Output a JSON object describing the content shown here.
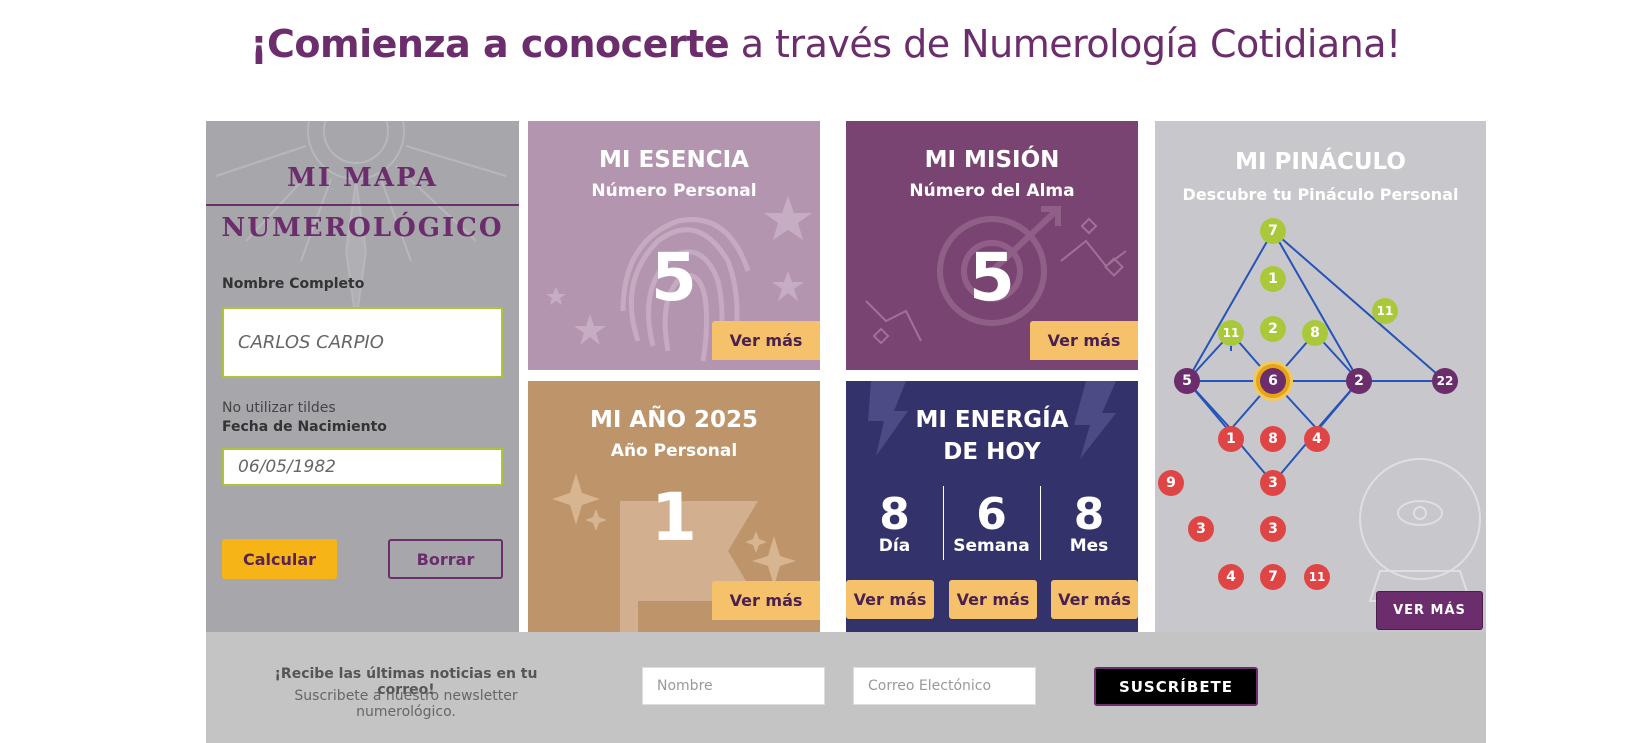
{
  "hero": {
    "bold": "¡Comienza a conocerte",
    "rest": " a través de Numerología Cotidiana!"
  },
  "mapa": {
    "title_line1": "MI MAPA",
    "title_line2": "NUMEROLÓGICO",
    "name_label": "Nombre Completo",
    "name_value": "CARLOS CARPIO",
    "name_hint": "No utilizar tildes",
    "date_label": "Fecha de Nacimiento",
    "date_value": "06/05/1982",
    "calc_button": "Calcular",
    "clear_button": "Borrar"
  },
  "cards": {
    "esencia": {
      "title": "MI ESENCIA",
      "subtitle": "Número Personal",
      "number": "5",
      "button": "Ver más"
    },
    "mision": {
      "title": "MI MISIÓN",
      "subtitle": "Número del Alma",
      "number": "5",
      "button": "Ver más"
    },
    "anio": {
      "title": "MI AÑO 2025",
      "subtitle": "Año Personal",
      "number": "1",
      "button": "Ver más"
    },
    "energia": {
      "title_line1": "MI ENERGÍA",
      "title_line2": "DE HOY",
      "items": [
        {
          "number": "8",
          "label": "Día",
          "button": "Ver más"
        },
        {
          "number": "6",
          "label": "Semana",
          "button": "Ver más"
        },
        {
          "number": "8",
          "label": "Mes",
          "button": "Ver más"
        }
      ]
    }
  },
  "pinaculo": {
    "title": "MI PINÁCULO",
    "subtitle": "Descubre tu Pináculo Personal",
    "button": "VER MÁS",
    "nodes": {
      "top": "7",
      "n1": "1",
      "n2": "2",
      "n11l": "11",
      "n8": "8",
      "n11r": "11",
      "left": "5",
      "center": "6",
      "right2": "2",
      "far": "22",
      "r1": "1",
      "r8": "8",
      "r4": "4",
      "r3a": "3",
      "r9": "9",
      "r3b": "3",
      "r3c": "3",
      "r4b": "4",
      "r7": "7",
      "r11": "11"
    },
    "colors": {
      "green": "#a9c93a",
      "purple": "#6b2d6b",
      "red": "#e04545",
      "gold": "#e7a416",
      "line": "#2553b8"
    }
  },
  "newsletter": {
    "headline": "¡Recibe las últimas noticias en tu correo!",
    "subline": "Suscribete a nuestro newsletter numerológico.",
    "name_placeholder": "Nombre",
    "email_placeholder": "Correo Electónico",
    "subscribe": "SUSCRÍBETE"
  }
}
